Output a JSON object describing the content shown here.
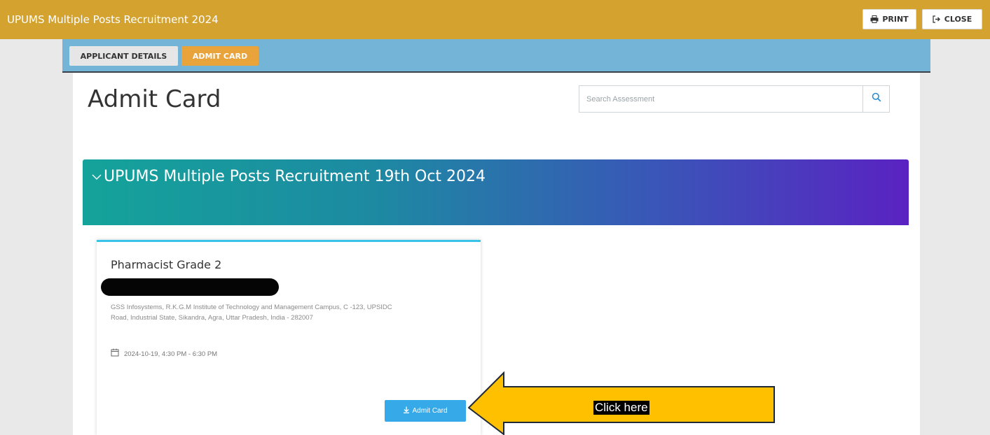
{
  "app": {
    "title": "UPUMS Multiple Posts Recruitment 2024",
    "print_label": "PRINT",
    "close_label": "CLOSE"
  },
  "tabs": [
    {
      "label": "APPLICANT DETAILS",
      "active": false
    },
    {
      "label": "ADMIT CARD",
      "active": true
    }
  ],
  "page": {
    "title": "Admit Card",
    "search_placeholder": "Search Assessment"
  },
  "section": {
    "title": "UPUMS Multiple Posts Recruitment 19th Oct 2024"
  },
  "assessment": {
    "post": "Pharmacist Grade 2",
    "address": "GSS Infosystems, R.K.G.M Institute of Technology and Management Campus, C -123, UPSIDC Road, Industrial State, Sikandra, Agra, Uttar Pradesh, India - 282007",
    "datetime": "2024-10-19, 4:30 PM - 6:30 PM",
    "admit_card_button": "Admit Card"
  },
  "annotation": {
    "label": "Click here"
  },
  "colors": {
    "topbar": "#d4a22f",
    "tabbar": "#74b4d6",
    "active_tab": "#e8a33a",
    "banner_start": "#14a39a",
    "banner_end": "#5a22c2",
    "button": "#36a9e8",
    "arrow_fill": "#ffc000"
  },
  "icons": {
    "print": "printer-icon",
    "close": "sign-out-icon",
    "search": "search-icon",
    "collapse": "chevron-down-icon",
    "date": "calendar-icon",
    "download": "download-icon"
  }
}
